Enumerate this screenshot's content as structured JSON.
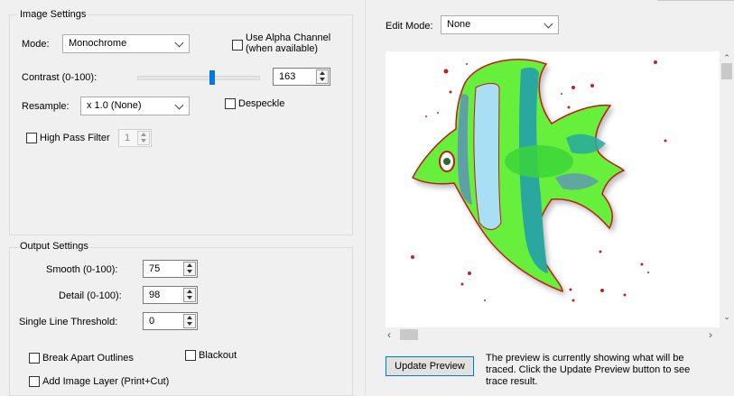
{
  "image_settings": {
    "title": "Image Settings",
    "mode_label": "Mode:",
    "mode_value": "Monochrome",
    "alpha_label_line1": "Use Alpha Channel",
    "alpha_label_line2": "(when available)",
    "alpha_checked": false,
    "contrast_label": "Contrast (0-100):",
    "contrast_value": "163",
    "resample_label": "Resample:",
    "resample_value": "x 1.0 (None)",
    "despeckle_label": "Despeckle",
    "despeckle_checked": false,
    "highpass_label": "High Pass Filter",
    "highpass_checked": false,
    "highpass_value": "1"
  },
  "output_settings": {
    "title": "Output Settings",
    "smooth_label": "Smooth (0-100):",
    "smooth_value": "75",
    "detail_label": "Detail (0-100):",
    "detail_value": "98",
    "threshold_label": "Single Line Threshold:",
    "threshold_value": "0",
    "break_apart_label": "Break Apart Outlines",
    "break_apart_checked": false,
    "blackout_label": "Blackout",
    "blackout_checked": false,
    "add_layer_label": "Add Image Layer (Print+Cut)",
    "add_layer_checked": false
  },
  "preview": {
    "edit_mode_label": "Edit Mode:",
    "edit_mode_value": "None",
    "update_button": "Update Preview",
    "info_line1": "The preview is currently showing what will be",
    "info_line2": "traced. Click the Update Preview button to see",
    "info_line3": "trace result.",
    "image": "angelfish-clipart"
  },
  "colors": {
    "fish_green": "#66ef3a",
    "fish_blue": "#a9dff4",
    "fish_teal": "#2aa8a0",
    "fish_outline": "#c01a12",
    "dots": "#c8201c"
  }
}
